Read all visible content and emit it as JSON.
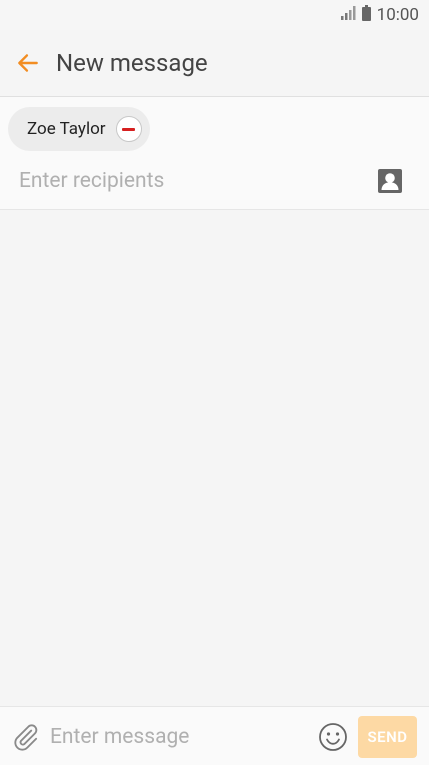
{
  "status_bar": {
    "time": "10:00"
  },
  "header": {
    "title": "New message"
  },
  "recipients": {
    "chips": [
      {
        "name": "Zoe Taylor"
      }
    ],
    "input_placeholder": "Enter recipients",
    "input_value": ""
  },
  "composer": {
    "placeholder": "Enter message",
    "value": "",
    "send_label": "SEND"
  },
  "colors": {
    "accent": "#f28d22",
    "send_disabled": "#fdd9a4",
    "remove_red": "#d62020"
  },
  "icons": {
    "back": "back-arrow-icon",
    "contact": "contact-icon",
    "attach": "paperclip-icon",
    "emoji": "emoji-icon",
    "signal": "signal-icon",
    "battery": "battery-icon"
  }
}
